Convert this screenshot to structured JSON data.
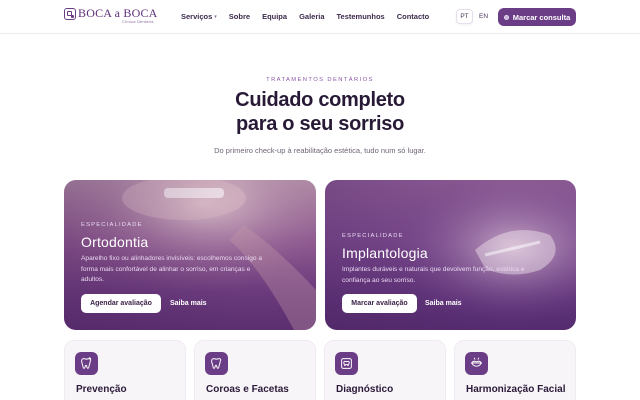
{
  "brand": {
    "name": "BOCA a BOCA",
    "tagline": "Clínica Dentária"
  },
  "nav": {
    "items": [
      {
        "label": "Serviços",
        "has_dropdown": true
      },
      {
        "label": "Sobre"
      },
      {
        "label": "Equipa"
      },
      {
        "label": "Galeria"
      },
      {
        "label": "Testemunhos"
      },
      {
        "label": "Contacto"
      }
    ]
  },
  "languages": {
    "options": [
      "PT",
      "EN"
    ],
    "selected": "PT"
  },
  "header_cta": {
    "label": "Marcar consulta"
  },
  "hero": {
    "eyebrow": "TRATAMENTOS DENTÁRIOS",
    "title_line1": "Cuidado completo",
    "title_line2": "para o seu sorriso",
    "subtitle": "Do primeiro check-up à reabilitação estética, tudo num só lugar."
  },
  "features": [
    {
      "label": "ESPECIALIDADE",
      "title": "Ortodontia",
      "description": "Aparelho fixo ou alinhadores invisíveis: escolhemos consigo a forma mais confortável de alinhar o sorriso, em crianças e adultos.",
      "button": "Agendar avaliação",
      "link": "Saiba mais"
    },
    {
      "label": "ESPECIALIDADE",
      "title": "Implantologia",
      "description": "Implantes duráveis e naturais que devolvem função, estética e confiança ao seu sorriso.",
      "button": "Marcar avaliação",
      "link": "Saiba mais"
    }
  ],
  "services": [
    {
      "title": "Prevenção",
      "icon": "tooth-sparkle-icon"
    },
    {
      "title": "Coroas e Facetas",
      "icon": "tooth-icon"
    },
    {
      "title": "Diagnóstico",
      "icon": "xray-icon"
    },
    {
      "title": "Harmonização Facial",
      "icon": "smile-lips-icon"
    }
  ],
  "colors": {
    "brand": "#6b3d86",
    "text_dark": "#281a36",
    "accent_light": "#8a57a6"
  }
}
